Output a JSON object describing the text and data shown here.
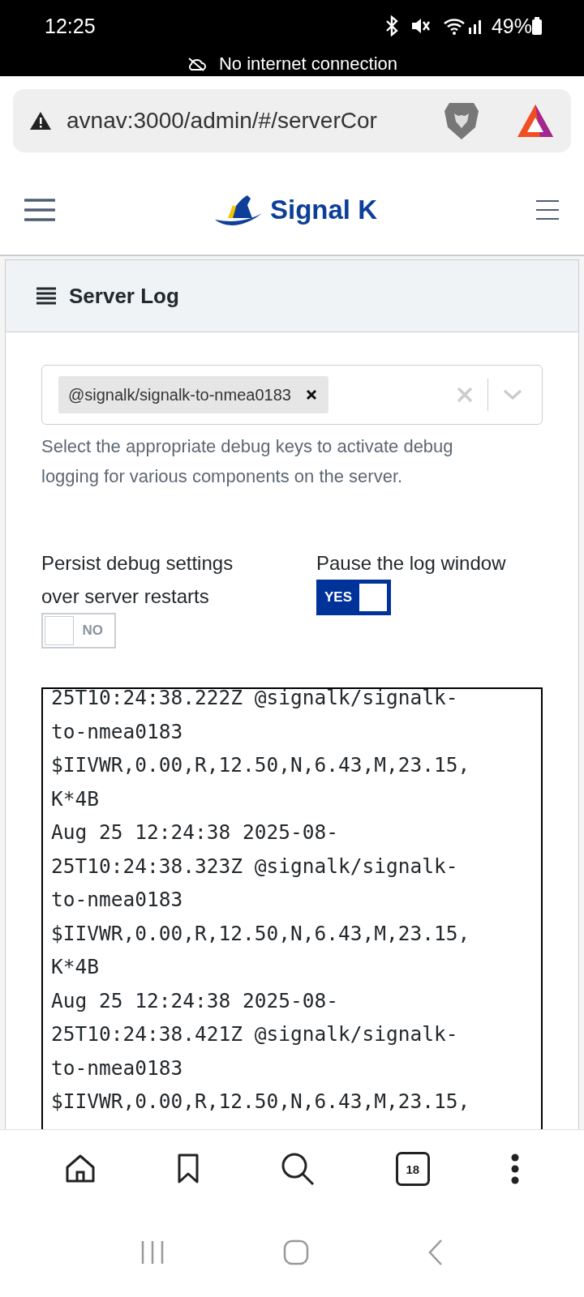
{
  "status_bar": {
    "time": "12:25",
    "battery": "49%",
    "notice": "No internet connection"
  },
  "browser": {
    "url": "avnav:3000/admin/#/serverCor",
    "tab_count": "18"
  },
  "app_header": {
    "brand": "Signal K"
  },
  "panel": {
    "title": "Server Log",
    "debug_select": {
      "tags": [
        {
          "label": "@signalk/signalk-to-nmea0183"
        }
      ]
    },
    "help": "Select the appropriate debug keys to activate debug logging for various components on the server.",
    "toggles": [
      {
        "label": "Persist debug settings over server restarts",
        "on": false,
        "state_label": "NO"
      },
      {
        "label": "Pause the log window",
        "on": true,
        "state_label": "YES"
      }
    ],
    "log_lines": [
      "25T10:24:38.222Z @signalk/signalk-",
      "to-nmea0183",
      "$IIVWR,0.00,R,12.50,N,6.43,M,23.15,",
      "K*4B",
      "Aug 25 12:24:38 2025-08-",
      "25T10:24:38.323Z @signalk/signalk-",
      "to-nmea0183",
      "$IIVWR,0.00,R,12.50,N,6.43,M,23.15,",
      "K*4B",
      "Aug 25 12:24:38 2025-08-",
      "25T10:24:38.421Z @signalk/signalk-",
      "to-nmea0183",
      "$IIVWR,0.00,R,12.50,N,6.43,M,23.15,"
    ]
  }
}
